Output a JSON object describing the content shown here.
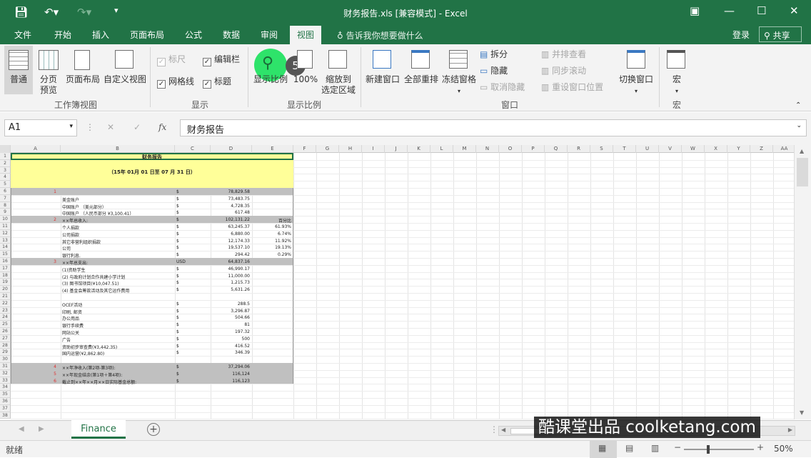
{
  "window": {
    "title": "财务报告.xls  [兼容模式] - Excel"
  },
  "ribbon_tabs": [
    "文件",
    "开始",
    "插入",
    "页面布局",
    "公式",
    "数据",
    "审阅",
    "视图"
  ],
  "tell_me": "告诉我你想要做什么",
  "account": {
    "login": "登录",
    "share": "共享"
  },
  "ribbon": {
    "workbook_views": {
      "normal": "普通",
      "page_break_line1": "分页",
      "page_break_line2": "预览",
      "page_layout": "页面布局",
      "custom_views": "自定义视图",
      "group": "工作簿视图"
    },
    "show": {
      "ruler": "标尺",
      "formula_bar": "编辑栏",
      "gridlines": "网格线",
      "headings": "标题",
      "group": "显示"
    },
    "zoom": {
      "zoom": "显示比例",
      "zoom100": "100%",
      "zoom_sel_line1": "缩放到",
      "zoom_sel_line2": "选定区域",
      "group": "显示比例",
      "step_badge": "5"
    },
    "window": {
      "new_window": "新建窗口",
      "arrange_all": "全部重排",
      "freeze": "冻结窗格",
      "split": "拆分",
      "hide": "隐藏",
      "unhide": "取消隐藏",
      "side_by_side": "并排查看",
      "sync_scroll": "同步滚动",
      "reset_pos": "重设窗口位置",
      "switch": "切换窗口",
      "group": "窗口"
    },
    "macros": {
      "macro": "宏",
      "group": "宏"
    }
  },
  "formula_bar": {
    "name_box": "A1",
    "cancel": "✕",
    "enter": "✓",
    "fx": "fx",
    "content": "财务报告"
  },
  "columns": [
    "A",
    "B",
    "C",
    "D",
    "E",
    "F",
    "G",
    "H",
    "I",
    "J",
    "K",
    "L",
    "M",
    "N",
    "O",
    "P",
    "Q",
    "R",
    "S",
    "T",
    "U",
    "V",
    "W",
    "X",
    "Y",
    "Z",
    "AA"
  ],
  "rows": [
    "1",
    "2",
    "3",
    "4",
    "5",
    "6",
    "7",
    "8",
    "9",
    "10",
    "11",
    "12",
    "13",
    "14",
    "15",
    "16",
    "17",
    "18",
    "19",
    "20",
    "21",
    "22",
    "23",
    "24",
    "25",
    "26",
    "27",
    "28",
    "29",
    "30",
    "31",
    "32",
    "33",
    "34",
    "35",
    "36",
    "37",
    "38"
  ],
  "report": {
    "title": "财务报告",
    "period": "（15年 01月 01 日至 07 月 31 日）",
    "rows": [
      {
        "row": 6,
        "num": "1",
        "label": "",
        "cur": "$",
        "amount": "78,829.58",
        "pct": "",
        "band": true
      },
      {
        "row": 7,
        "num": "",
        "label": "美金账户",
        "cur": "$",
        "amount": "73,483.75",
        "pct": ""
      },
      {
        "row": 8,
        "num": "",
        "label": "中国账户 （美元部分）",
        "cur": "$",
        "amount": "4,728.35",
        "pct": ""
      },
      {
        "row": 9,
        "num": "",
        "label": "中国账户 （人民币部分 ¥3,100.41）",
        "cur": "$",
        "amount": "617.48",
        "pct": ""
      },
      {
        "row": 10,
        "num": "2",
        "label": "××年总收入:",
        "cur": "$",
        "amount": "102,131.22",
        "pct": "百分比",
        "band": true
      },
      {
        "row": 11,
        "num": "",
        "label": "个人捐款",
        "cur": "$",
        "amount": "63,245.37",
        "pct": "61.93%"
      },
      {
        "row": 12,
        "num": "",
        "label": "公司捐款",
        "cur": "$",
        "amount": "6,880.00",
        "pct": "6.74%"
      },
      {
        "row": 13,
        "num": "",
        "label": "其它非营利组织捐款",
        "cur": "$",
        "amount": "12,174.33",
        "pct": "11.92%"
      },
      {
        "row": 14,
        "num": "",
        "label": "公司",
        "cur": "$",
        "amount": "19,537.10",
        "pct": "19.13%"
      },
      {
        "row": 15,
        "num": "",
        "label": "银行利息.",
        "cur": "$",
        "amount": "294.42",
        "pct": "0.29%"
      },
      {
        "row": 16,
        "num": "3",
        "label": "××年总支出:",
        "cur": "USD",
        "amount": "64,837.16",
        "pct": "",
        "band": true
      },
      {
        "row": 17,
        "num": "",
        "label": "(1)资助学生",
        "cur": "$",
        "amount": "46,990.17",
        "pct": ""
      },
      {
        "row": 18,
        "num": "",
        "label": "(2) 与政府计划合作共建小学计划",
        "cur": "$",
        "amount": "11,000.00",
        "pct": ""
      },
      {
        "row": 19,
        "num": "",
        "label": "(3) 图书馆项目(¥10,047.51)",
        "cur": "$",
        "amount": "1,215.73",
        "pct": ""
      },
      {
        "row": 20,
        "num": "",
        "label": "(4) 基金会筹款活动及其它运作费用",
        "cur": "$",
        "amount": "5,631.26",
        "pct": ""
      },
      {
        "row": 22,
        "num": "",
        "label": "   OCEF活动",
        "cur": "$",
        "amount": "288.5",
        "pct": ""
      },
      {
        "row": 23,
        "num": "",
        "label": "   印刷, 邮资",
        "cur": "$",
        "amount": "3,296.87",
        "pct": ""
      },
      {
        "row": 24,
        "num": "",
        "label": "   办公用品",
        "cur": "$",
        "amount": "504.66",
        "pct": ""
      },
      {
        "row": 25,
        "num": "",
        "label": "   银行手续费",
        "cur": "$",
        "amount": "81",
        "pct": ""
      },
      {
        "row": 26,
        "num": "",
        "label": "   网站公关",
        "cur": "$",
        "amount": "197.32",
        "pct": ""
      },
      {
        "row": 27,
        "num": "",
        "label": "   广告",
        "cur": "$",
        "amount": "500",
        "pct": ""
      },
      {
        "row": 28,
        "num": "",
        "label": "   资助初步审查费(¥3,442.35)",
        "cur": "$",
        "amount": "416.52",
        "pct": ""
      },
      {
        "row": 29,
        "num": "",
        "label": "   国内运营(¥2,862.80)",
        "cur": "$",
        "amount": "346.39",
        "pct": ""
      },
      {
        "row": 31,
        "num": "4",
        "label": "××年净收入(第2项-第3项):",
        "cur": "$",
        "amount": "37,294.06",
        "pct": "",
        "band": true
      },
      {
        "row": 32,
        "num": "5",
        "label": "××年现金结余(第1项＋第4项):",
        "cur": "$",
        "amount": "116,124",
        "pct": "",
        "band": true
      },
      {
        "row": 33,
        "num": "6",
        "label": "截止到××年××月××日实际基金总额:",
        "cur": "$",
        "amount": "116,123",
        "pct": "",
        "band": true
      }
    ]
  },
  "sheet_tab": "Finance",
  "status": {
    "ready": "就绪",
    "zoom": "50%",
    "minus": "−",
    "plus": "+"
  },
  "watermark": "酷课堂出品 coolketang.com",
  "colors": {
    "excel_green": "#217346",
    "title_yellow": "#ffff99",
    "band_gray": "#c0c0c0",
    "row_num_red": "#e03030",
    "zoom_highlight": "#2ee36a"
  }
}
